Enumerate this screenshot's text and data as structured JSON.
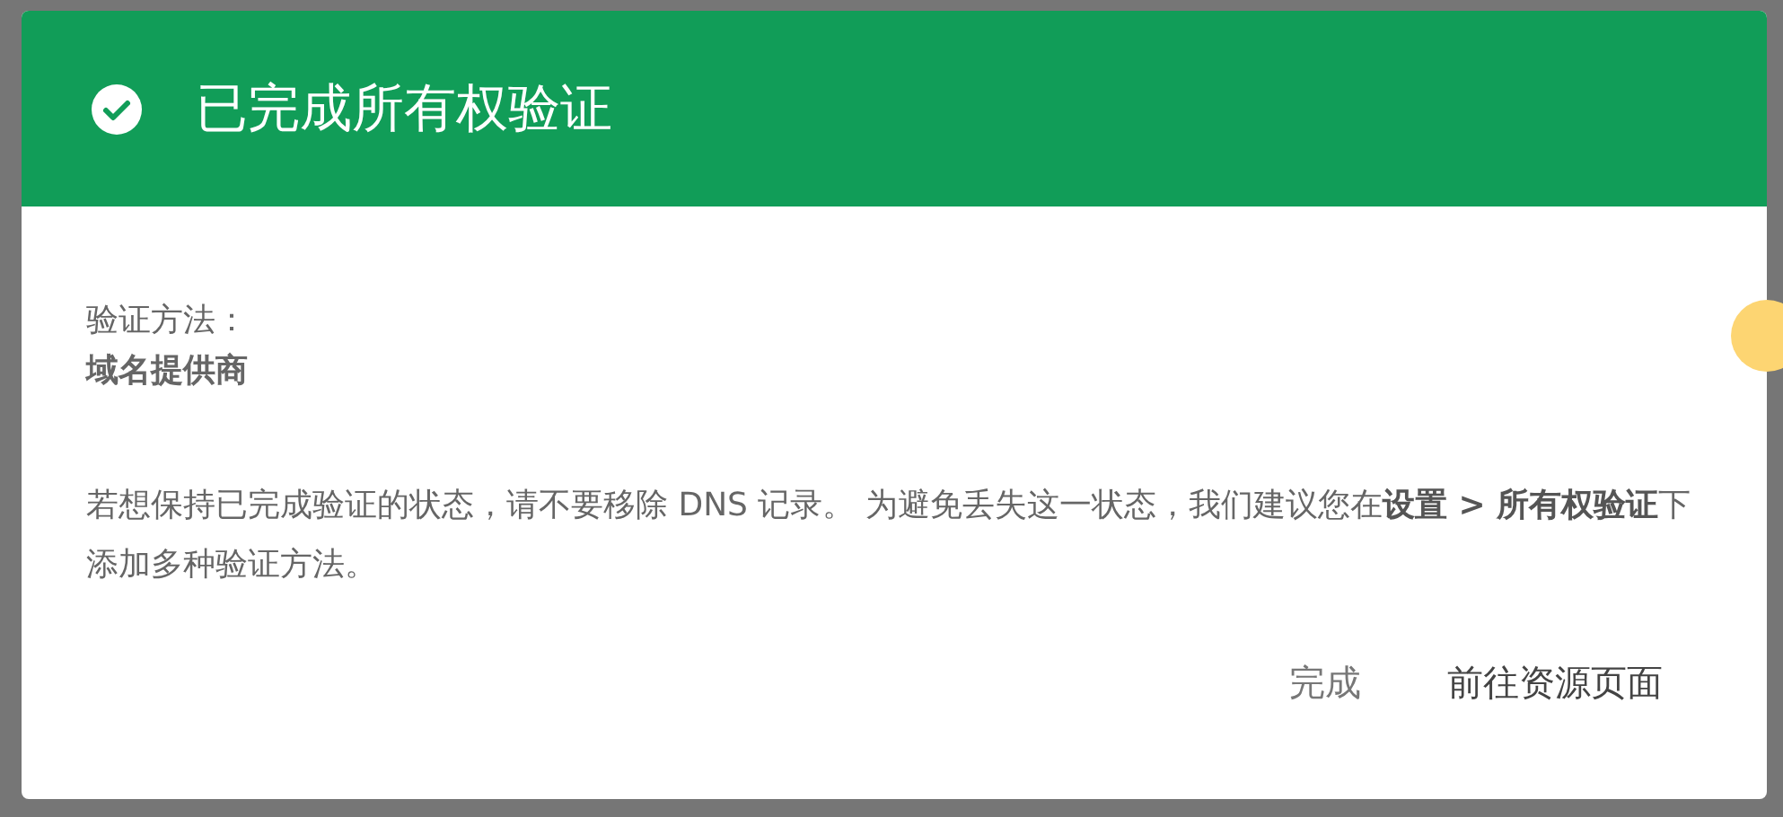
{
  "dialog": {
    "title": "已完成所有权验证",
    "method_label": "验证方法：",
    "method_value": "域名提供商",
    "message": "若想保持已完成验证的状态，请不要移除 DNS 记录。 为避免丢失这一状态，我们建议您在**设置 > 所有权验证**下添加多种验证方法。",
    "buttons": [
      {
        "label": "完成",
        "kind": "secondary"
      },
      {
        "label": "前往资源页面",
        "kind": "primary"
      }
    ]
  }
}
